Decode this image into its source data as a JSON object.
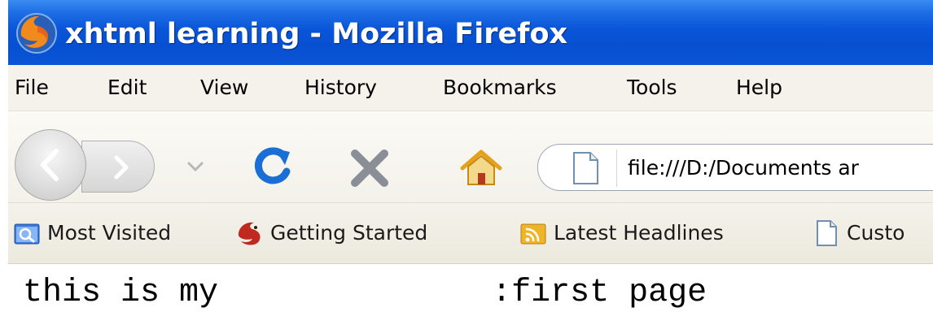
{
  "window": {
    "title": "xhtml learning - Mozilla Firefox",
    "app_icon": "firefox-icon"
  },
  "menubar": {
    "items": [
      "File",
      "Edit",
      "View",
      "History",
      "Bookmarks",
      "Tools",
      "Help"
    ]
  },
  "toolbar": {
    "back_icon": "back-arrow-icon",
    "forward_icon": "forward-arrow-icon",
    "history_icon": "chevron-down-icon",
    "reload_icon": "reload-icon",
    "stop_icon": "stop-icon",
    "home_icon": "home-icon",
    "reload_color": "#1a6fd6",
    "stop_color": "#8a8f97"
  },
  "address_bar": {
    "value": "file:///D:/Documents ar",
    "page_icon": "page-icon"
  },
  "bookmarks": {
    "items": [
      {
        "label": "Most Visited",
        "icon": "folder-search-icon"
      },
      {
        "label": "Getting Started",
        "icon": "firefox-icon"
      },
      {
        "label": "Latest Headlines",
        "icon": "rss-feed-icon"
      },
      {
        "label": "Custo",
        "icon": "page-icon"
      }
    ]
  },
  "page": {
    "text": "this is my              :first page"
  },
  "colors": {
    "titlebar": "#0a55d8",
    "menubar_bg": "#f4f2ea"
  }
}
